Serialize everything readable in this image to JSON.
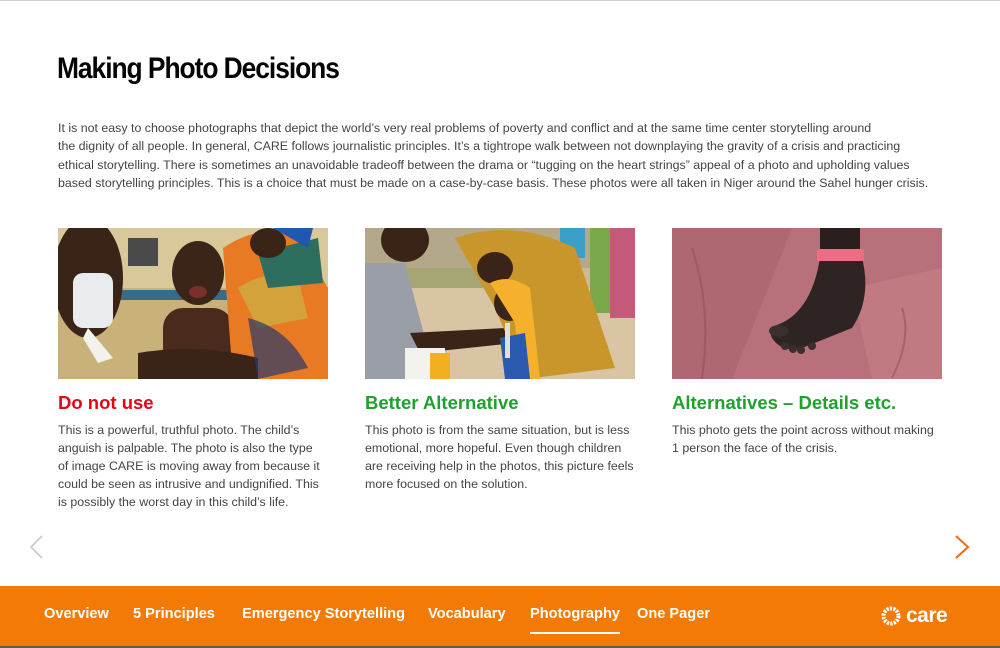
{
  "page": {
    "title": "Making Photo Decisions",
    "intro_lines": [
      "It is not easy to choose photographs that depict the world’s very real problems of poverty and conflict and at the same time center storytelling around",
      "the dignity of all people. In general, CARE follows journalistic principles. It’s a tightrope walk between not downplaying the gravity of a crisis and practicing",
      "ethical storytelling. There is sometimes an unavoidable tradeoff between the drama or “tugging on the heart strings” appeal of a photo and upholding values",
      "based storytelling principles. This is a choice that must be made on a case-by-case basis. These photos were all taken in Niger around the Sahel hunger crisis."
    ]
  },
  "cards": [
    {
      "title": "Do not use",
      "title_color": "#e30613",
      "photo_alt": "Crying malnourished child held by adults in a clinic",
      "body_lines": [
        "This is a powerful, truthful photo. The child’s",
        "anguish is palpable. The photo is also the type",
        "of image CARE is moving away from because it",
        "could be seen as intrusive and undignified. This",
        "is possibly the worst day in this child’s life."
      ]
    },
    {
      "title": "Better Alternative",
      "title_color": "#1fa12e",
      "photo_alt": "Health worker measuring a child's arm while mother holds her",
      "body_lines": [
        "This photo is from the same situation, but is less",
        "emotional, more hopeful. Even though children",
        "are receiving help in the photos, this picture feels",
        "more focused on the solution."
      ]
    },
    {
      "title": "Alternatives – Details etc.",
      "title_color": "#1fa12e",
      "photo_alt": "Close-up of a child's foot with a pink wristband on pink cloth",
      "body_lines": [
        "This photo gets the point across without making",
        "1 person the face of the crisis."
      ]
    }
  ],
  "carousel": {
    "prev_icon": "chevron-left-icon",
    "next_icon": "chevron-right-icon",
    "prev_color": "#c8c8c8",
    "next_color": "#f26a0a"
  },
  "nav": {
    "items": [
      {
        "label": "Overview",
        "active": false
      },
      {
        "label": "5 Principles",
        "active": false
      },
      {
        "label": "Emergency Storytelling",
        "active": false
      },
      {
        "label": "Vocabulary",
        "active": false
      },
      {
        "label": "Photography",
        "active": true
      },
      {
        "label": "One Pager",
        "active": false
      }
    ],
    "background": "#f47a06",
    "logo_text": "care",
    "logo_mark": "·"
  }
}
